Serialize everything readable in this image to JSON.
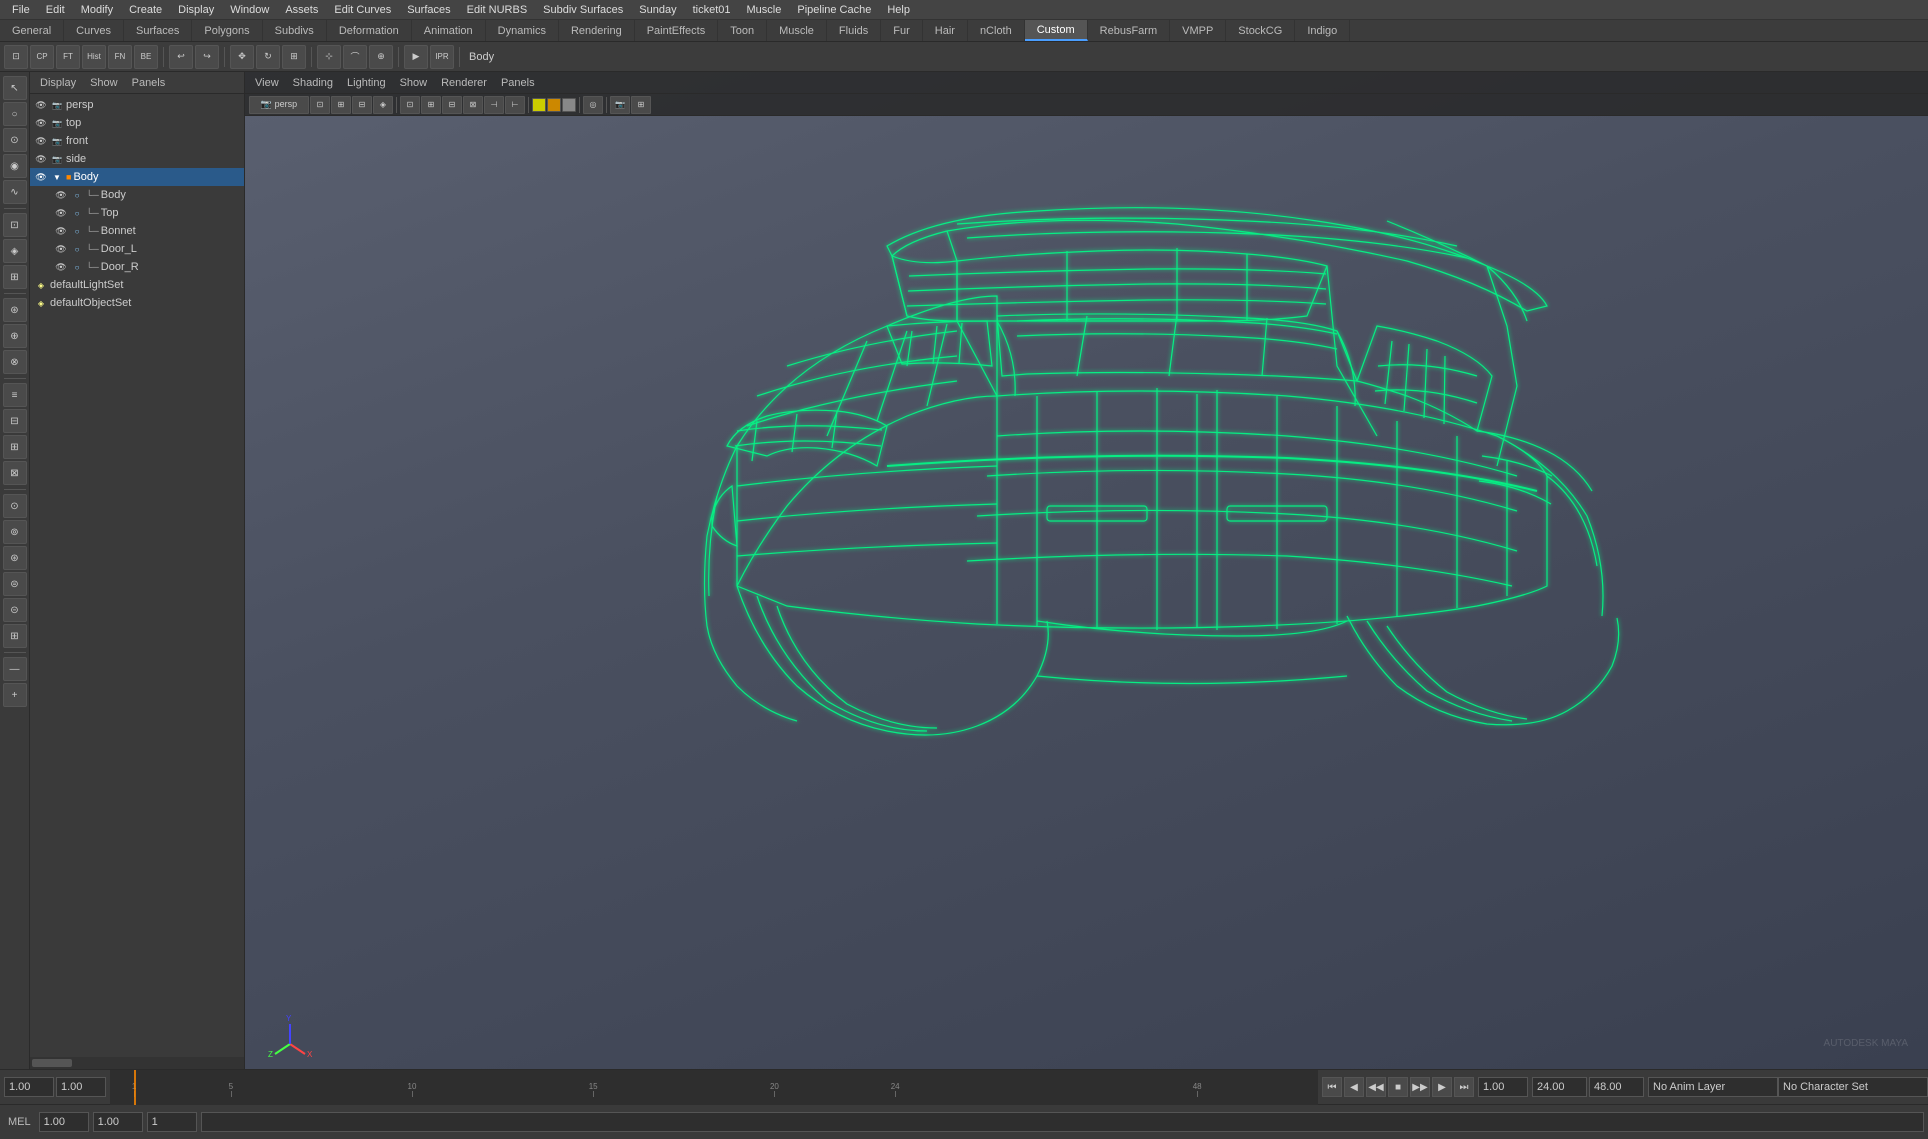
{
  "app": {
    "title": "Maya",
    "active_object": "Body"
  },
  "menu_bar": {
    "items": [
      "File",
      "Edit",
      "Modify",
      "Create",
      "Display",
      "Window",
      "Assets",
      "Edit Curves",
      "Surfaces",
      "Edit NURBS",
      "Subdiv Surfaces",
      "Sunday",
      "ticket01",
      "Muscle",
      "Pipeline Cache",
      "Help"
    ]
  },
  "tabs": {
    "items": [
      "General",
      "Curves",
      "Surfaces",
      "Polygons",
      "Subdivs",
      "Deformation",
      "Animation",
      "Dynamics",
      "Rendering",
      "PaintEffects",
      "Toon",
      "Muscle",
      "Fluids",
      "Fur",
      "Hair",
      "nCloth",
      "Custom",
      "RebusFarm",
      "VMPP",
      "StockCG",
      "Indigo"
    ],
    "active": "Custom"
  },
  "outliner": {
    "header": [
      "Display",
      "Show",
      "Panels"
    ],
    "items": [
      {
        "label": "persp",
        "indent": 0,
        "type": "camera",
        "visible": true
      },
      {
        "label": "top",
        "indent": 0,
        "type": "camera",
        "visible": true
      },
      {
        "label": "front",
        "indent": 0,
        "type": "camera",
        "visible": true
      },
      {
        "label": "side",
        "indent": 0,
        "type": "camera",
        "visible": true
      },
      {
        "label": "Body",
        "indent": 0,
        "type": "group",
        "visible": true,
        "selected": true
      },
      {
        "label": "Body",
        "indent": 1,
        "type": "mesh",
        "visible": true
      },
      {
        "label": "Top",
        "indent": 1,
        "type": "mesh",
        "visible": true
      },
      {
        "label": "Bonnet",
        "indent": 1,
        "type": "mesh",
        "visible": true
      },
      {
        "label": "Door_L",
        "indent": 1,
        "type": "mesh",
        "visible": true
      },
      {
        "label": "Door_R",
        "indent": 1,
        "type": "mesh",
        "visible": true
      },
      {
        "label": "defaultLightSet",
        "indent": 0,
        "type": "light",
        "visible": true
      },
      {
        "label": "defaultObjectSet",
        "indent": 0,
        "type": "set",
        "visible": true
      }
    ]
  },
  "viewport": {
    "menu": [
      "View",
      "Shading",
      "Lighting",
      "Show",
      "Renderer",
      "Panels"
    ],
    "mode": "wireframe",
    "camera": "persp",
    "watermark": "AUTODESK MAYA",
    "axis_labels": {
      "x": "X",
      "y": "Y",
      "z": "Z"
    }
  },
  "timeline": {
    "start": 1,
    "end": 24,
    "current": 1,
    "ticks": [
      1,
      5,
      10,
      15,
      20,
      24,
      48
    ],
    "range_start": "1.00",
    "range_end": "1.00",
    "current_frame": "1",
    "anim_end": "24.00",
    "anim_end2": "48.00",
    "anim_layer": "No Anim Layer",
    "character_set": "No Character Set"
  },
  "bottom_bar": {
    "mel_label": "MEL",
    "mel_placeholder": "",
    "frame_value1": "1.00",
    "frame_value2": "1.00",
    "frame_value3": "1"
  },
  "colors": {
    "wireframe": "#00ff88",
    "viewport_bg_top": "#5a6070",
    "viewport_bg_bottom": "#3a4050",
    "selected_bg": "#2a5a8a",
    "tab_active_bg": "#555555"
  }
}
